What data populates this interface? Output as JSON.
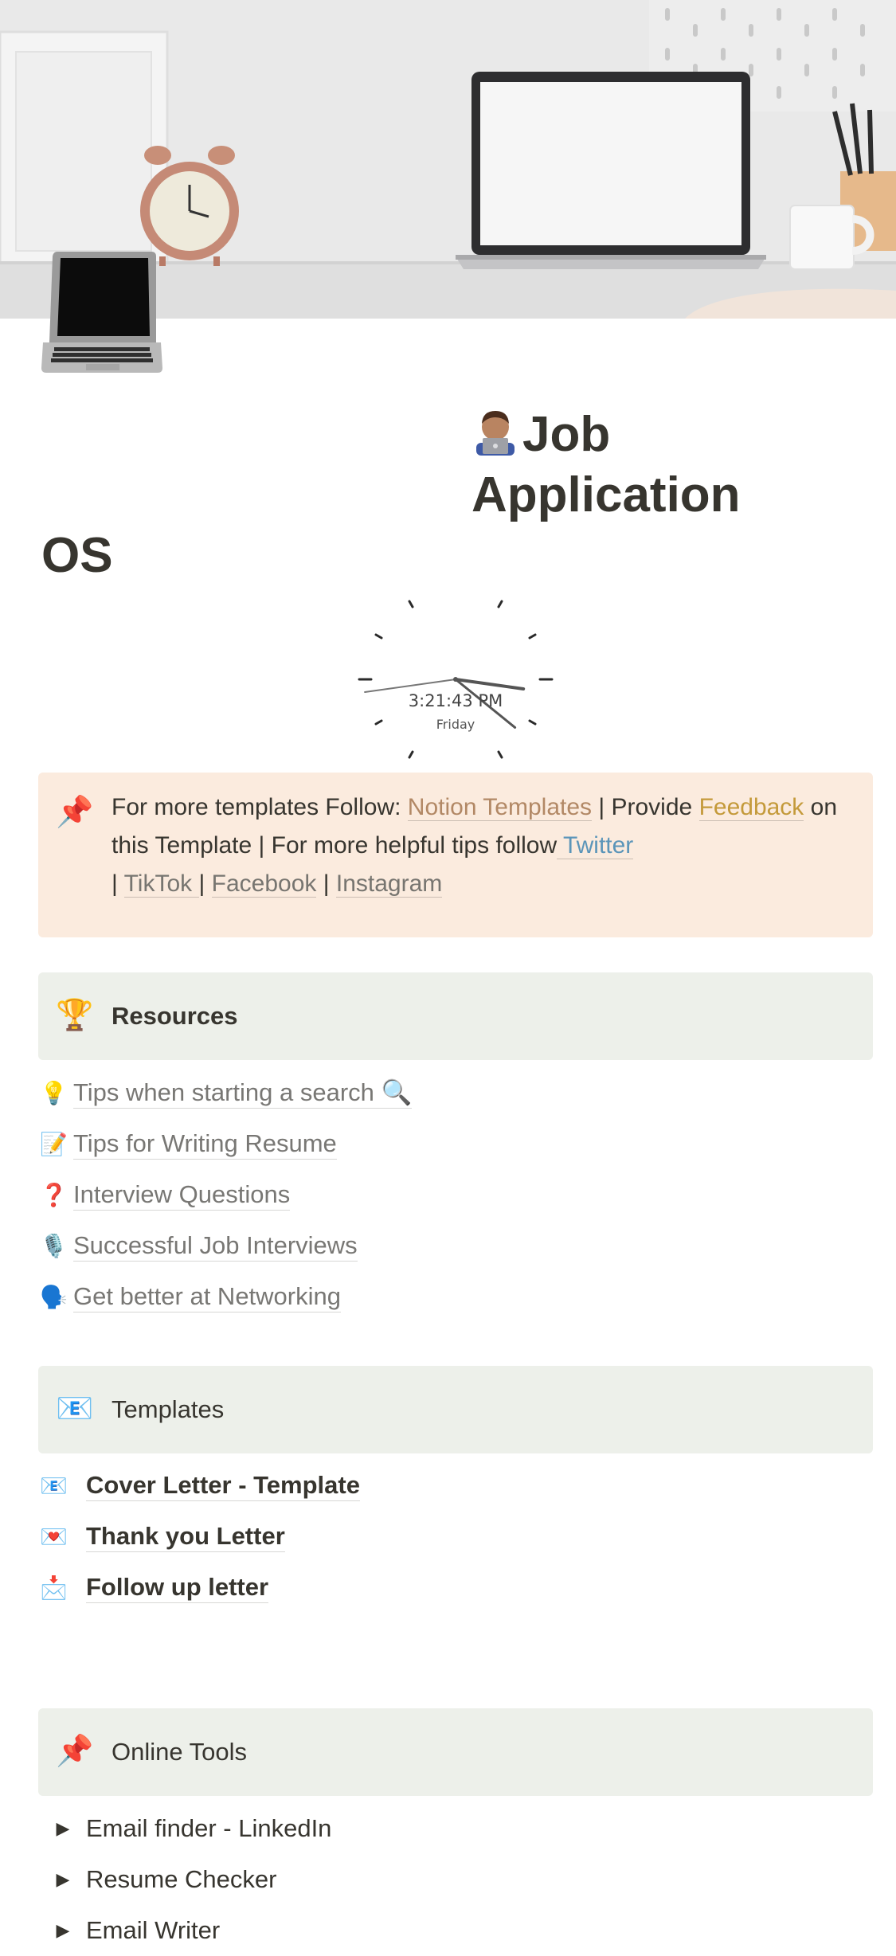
{
  "page": {
    "title_line1": "Job Application",
    "title_line2": "OS"
  },
  "clock": {
    "time": "3:21:43 PM",
    "day": "Friday",
    "hour_hand_angle": 98,
    "minute_hand_angle": 129,
    "second_hand_angle": 262
  },
  "info_callout": {
    "emoji": "📌",
    "text_1": "For more templates Follow: ",
    "link_notion": "Notion Templates",
    "text_2": " | Provide ",
    "link_feedback": "Feedback",
    "text_3": " on this Template | For more helpful tips follow",
    "link_twitter": " Twitter ",
    "sep_1": " | ",
    "link_tiktok": "TikTok ",
    "sep_2": " | ",
    "link_facebook": "Facebook",
    "sep_3": " | ",
    "link_instagram": "Instagram"
  },
  "resources": {
    "emoji": "🏆",
    "heading": "Resources",
    "items": [
      {
        "icon": "💡",
        "label": "Tips when starting a search 🔍"
      },
      {
        "icon": "📝",
        "label": "Tips for Writing Resume "
      },
      {
        "icon": "❓",
        "label": "Interview Questions"
      },
      {
        "icon": "🎙️",
        "label": "Successful Job Interviews"
      },
      {
        "icon": "🗣️",
        "label": "Get better at Networking "
      }
    ]
  },
  "templates": {
    "emoji": "📧",
    "heading": "Templates",
    "items": [
      {
        "icon": "📧",
        "label": "Cover Letter - Template"
      },
      {
        "icon": "💌",
        "label": "Thank you Letter"
      },
      {
        "icon": "📩",
        "label": "Follow up letter"
      }
    ]
  },
  "online_tools": {
    "emoji": "📌",
    "heading": "Online Tools",
    "toggle_icon": "▶",
    "items": [
      {
        "label": "Email finder - LinkedIn"
      },
      {
        "label": "Resume Checker"
      },
      {
        "label": "Email Writer"
      }
    ]
  }
}
